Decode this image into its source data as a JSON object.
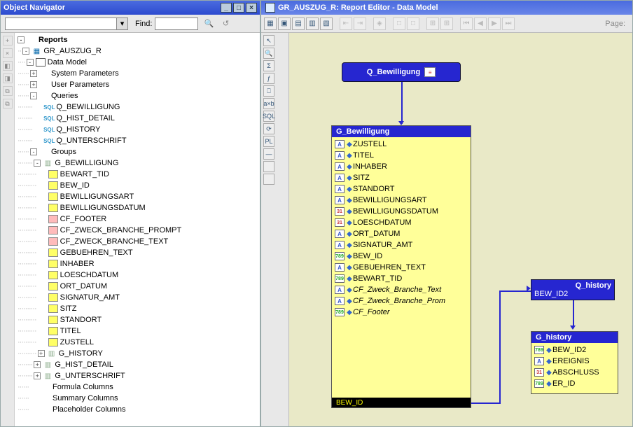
{
  "nav": {
    "title": "Object Navigator",
    "find_label": "Find:"
  },
  "tree": {
    "root": "Reports",
    "report": "GR_AUSZUG_R",
    "dm": "Data Model",
    "sysparam": "System Parameters",
    "userparam": "User Parameters",
    "queries": "Queries",
    "q1": "Q_BEWILLIGUNG",
    "q2": "Q_HIST_DETAIL",
    "q3": "Q_HISTORY",
    "q4": "Q_UNTERSCHRIFT",
    "groups": "Groups",
    "g1": "G_BEWILLIGUNG",
    "g1_cols": [
      "BEWART_TID",
      "BEW_ID",
      "BEWILLIGUNGSART",
      "BEWILLIGUNGSDATUM",
      "CF_FOOTER",
      "CF_ZWECK_BRANCHE_PROMPT",
      "CF_ZWECK_BRANCHE_TEXT",
      "GEBUEHREN_TEXT",
      "INHABER",
      "LOESCHDATUM",
      "ORT_DATUM",
      "SIGNATUR_AMT",
      "SITZ",
      "STANDORT",
      "TITEL",
      "ZUSTELL"
    ],
    "g2": "G_HISTORY",
    "g3": "G_HIST_DETAIL",
    "g4": "G_UNTERSCHRIFT",
    "fc": "Formula Columns",
    "sc": "Summary Columns",
    "pc": "Placeholder Columns"
  },
  "editor": {
    "title": "GR_AUSZUG_R: Report Editor - Data Model",
    "page_label": "Page:"
  },
  "diagram": {
    "q_bew": "Q_Bewilligung",
    "g_bew": "G_Bewilligung",
    "g_bew_cols": [
      {
        "k": "A",
        "l": "ZUSTELL"
      },
      {
        "k": "A",
        "l": "TITEL"
      },
      {
        "k": "A",
        "l": "INHABER"
      },
      {
        "k": "A",
        "l": "SITZ"
      },
      {
        "k": "A",
        "l": "STANDORT"
      },
      {
        "k": "A",
        "l": "BEWILLIGUNGSART"
      },
      {
        "k": "D",
        "l": "BEWILLIGUNGSDATUM"
      },
      {
        "k": "D",
        "l": "LOESCHDATUM"
      },
      {
        "k": "A",
        "l": "ORT_DATUM"
      },
      {
        "k": "A",
        "l": "SIGNATUR_AMT"
      },
      {
        "k": "N",
        "l": "BEW_ID"
      },
      {
        "k": "A",
        "l": "GEBUEHREN_TEXT"
      },
      {
        "k": "N",
        "l": "BEWART_TID"
      },
      {
        "k": "A",
        "l": "CF_Zweck_Branche_Text",
        "it": true
      },
      {
        "k": "A",
        "l": "CF_Zweck_Branche_Prom",
        "it": true
      },
      {
        "k": "N",
        "l": "CF_Footer",
        "it": true
      }
    ],
    "g_bew_foot": "BEW_ID",
    "q_hist": "Q_history",
    "link_col": "BEW_ID2",
    "g_hist": "G_history",
    "g_hist_cols": [
      {
        "k": "N",
        "l": "BEW_ID2"
      },
      {
        "k": "A",
        "l": "EREIGNIS"
      },
      {
        "k": "D",
        "l": "ABSCHLUSS"
      },
      {
        "k": "N",
        "l": "ER_ID"
      }
    ]
  }
}
